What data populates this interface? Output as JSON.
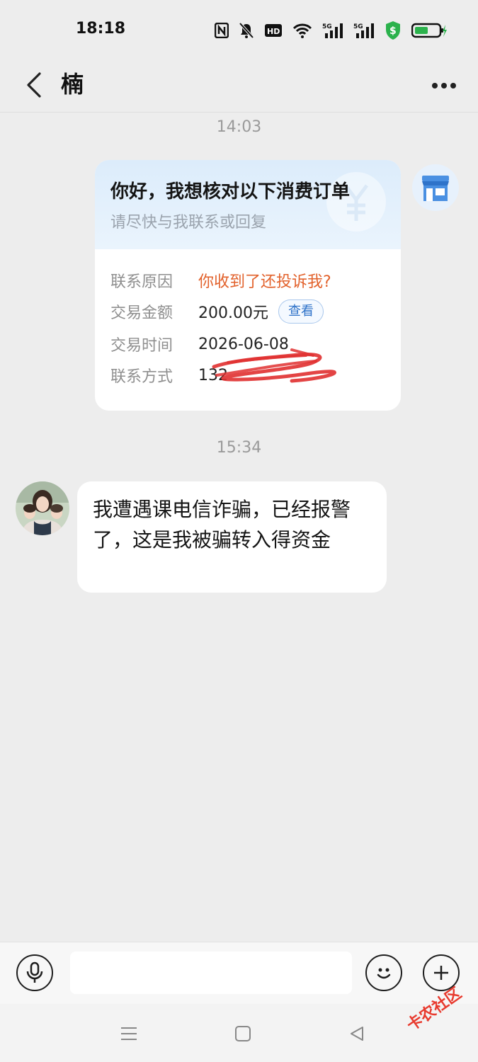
{
  "status_bar": {
    "time": "18:18"
  },
  "header": {
    "title": "楠"
  },
  "chat": {
    "timestamp_1": "14:03",
    "timestamp_2": "15:34",
    "order_card": {
      "title": "你好，我想核对以下消费订单",
      "subtitle": "请尽快与我联系或回复",
      "rows": [
        {
          "label": "联系原因",
          "value": "你收到了还投诉我?"
        },
        {
          "label": "交易金额",
          "value": "200.00元",
          "action": "查看"
        },
        {
          "label": "交易时间",
          "value": "2026-06-08"
        },
        {
          "label": "联系方式",
          "value": "132"
        }
      ]
    },
    "message": "我遭遇课电信诈骗，已经报警了，这是我被骗转入得资金"
  },
  "watermark": "卡农社区",
  "colors": {
    "accent_red": "#e2612b",
    "link_blue": "#2f73c9",
    "bg": "#ededed"
  }
}
